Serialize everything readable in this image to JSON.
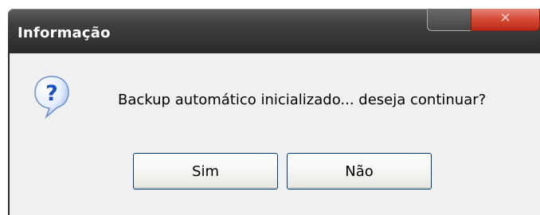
{
  "window": {
    "title": "Informação",
    "close_glyph": "✕"
  },
  "dialog": {
    "icon": "question-icon",
    "message": "Backup automático inicializado... deseja continuar?",
    "buttons": {
      "yes_label": "Sim",
      "no_label": "Não"
    }
  },
  "colors": {
    "titlebar": "#3a3a3a",
    "close_button": "#d44a35",
    "dialog_background": "#f0f0f0",
    "icon_blue": "#1c4fc4"
  }
}
